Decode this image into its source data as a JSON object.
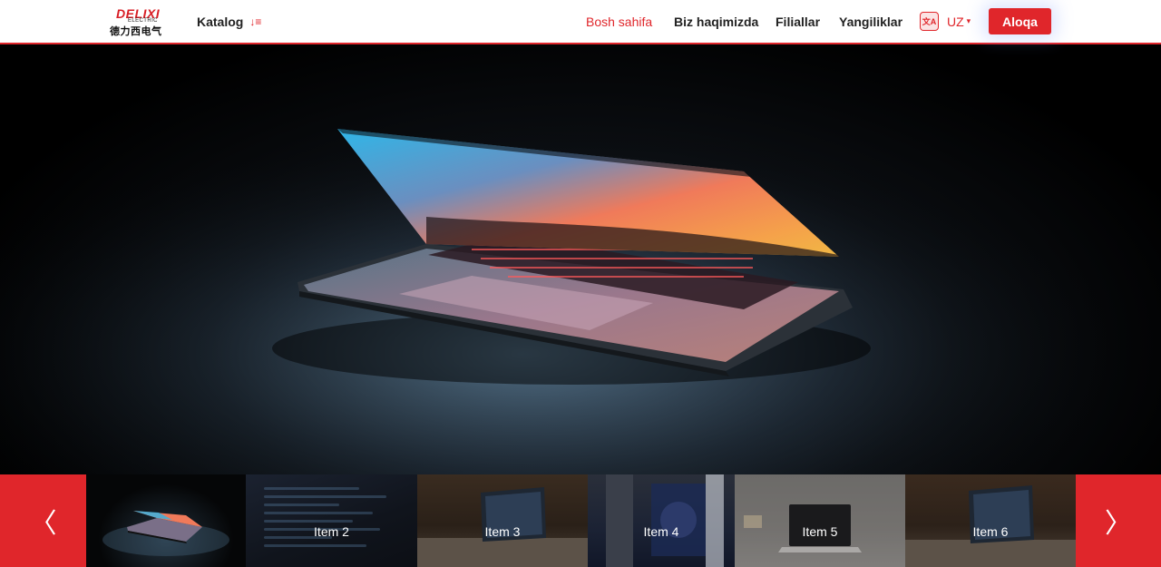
{
  "header": {
    "logo": {
      "brand": "DELIXI",
      "sub": "ELECTRIC",
      "cn": "德力西电气"
    },
    "catalog_label": "Katalog",
    "catalog_icon": "sort-list-icon",
    "nav": [
      {
        "label": "Bosh sahifa",
        "active": true
      },
      {
        "label": "Biz haqimizda",
        "active": false
      },
      {
        "label": "Filiallar",
        "active": false
      },
      {
        "label": "Yangiliklar",
        "active": false
      }
    ],
    "language": {
      "icon": "translate-icon",
      "code": "UZ"
    },
    "contact_button": "Aloqa"
  },
  "hero": {
    "image": "laptop-opened-in-dark-photo"
  },
  "thumbnails": [
    {
      "label": "",
      "image": "laptop-dark-photo",
      "active": true
    },
    {
      "label": "Item 2",
      "image": "code-screen-photo"
    },
    {
      "label": "Item 3",
      "image": "tablet-on-desk-photo"
    },
    {
      "label": "Item 4",
      "image": "pc-hardware-photo"
    },
    {
      "label": "Item 5",
      "image": "laptop-on-white-desk-photo"
    },
    {
      "label": "Item 6",
      "image": "tablet-on-wooden-desk-photo"
    }
  ],
  "carousel": {
    "prev_icon": "chevron-left-icon",
    "next_icon": "chevron-right-icon"
  },
  "colors": {
    "accent": "#e0262b",
    "text": "#222222",
    "header_bg": "#ffffff"
  }
}
